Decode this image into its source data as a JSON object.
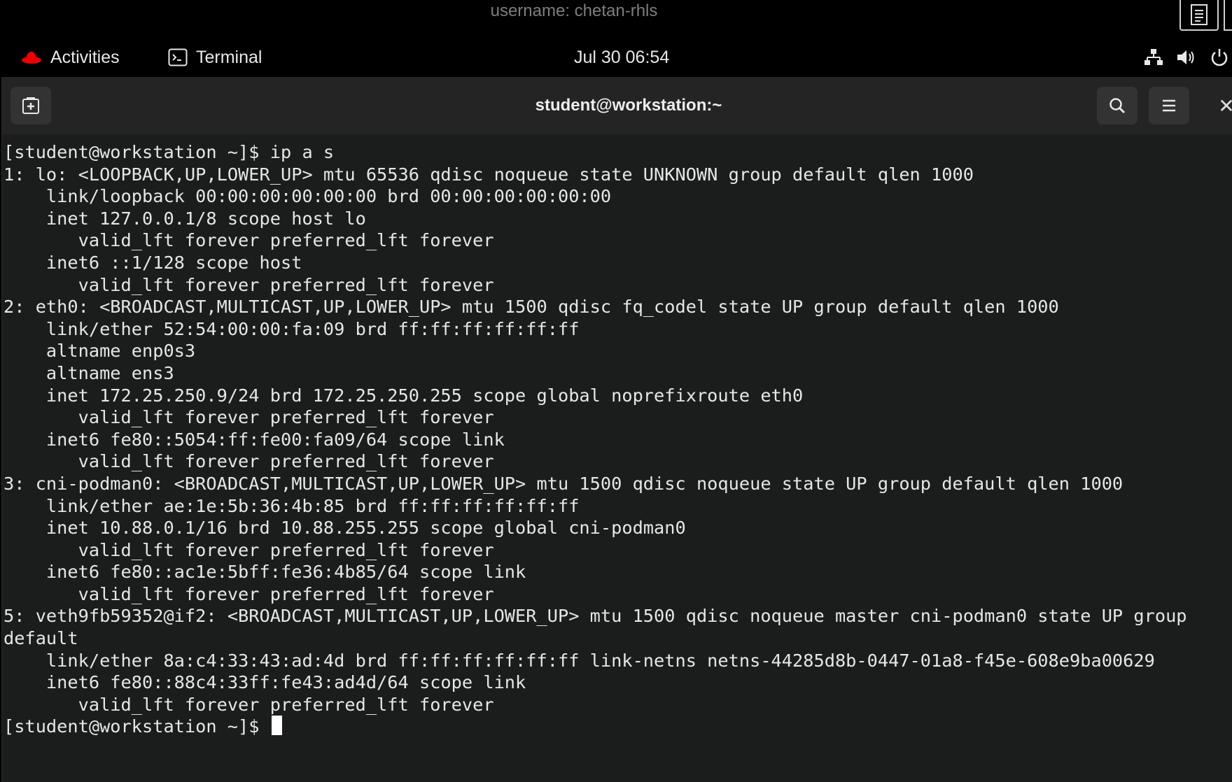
{
  "session": {
    "username_label": "username: chetan-rhls"
  },
  "panel": {
    "activities_label": "Activities",
    "app_label": "Terminal",
    "clock": "Jul 30  06:54",
    "icons": [
      "network-icon",
      "volume-icon",
      "power-icon"
    ]
  },
  "window": {
    "title": "student@workstation:~",
    "buttons": [
      "new-tab-icon",
      "search-icon",
      "hamburger-menu-icon",
      "close-icon"
    ]
  },
  "terminal": {
    "lines": [
      "[student@workstation ~]$ ip a s",
      "1: lo: <LOOPBACK,UP,LOWER_UP> mtu 65536 qdisc noqueue state UNKNOWN group default qlen 1000",
      "    link/loopback 00:00:00:00:00:00 brd 00:00:00:00:00:00",
      "    inet 127.0.0.1/8 scope host lo",
      "       valid_lft forever preferred_lft forever",
      "    inet6 ::1/128 scope host",
      "       valid_lft forever preferred_lft forever",
      "2: eth0: <BROADCAST,MULTICAST,UP,LOWER_UP> mtu 1500 qdisc fq_codel state UP group default qlen 1000",
      "    link/ether 52:54:00:00:fa:09 brd ff:ff:ff:ff:ff:ff",
      "    altname enp0s3",
      "    altname ens3",
      "    inet 172.25.250.9/24 brd 172.25.250.255 scope global noprefixroute eth0",
      "       valid_lft forever preferred_lft forever",
      "    inet6 fe80::5054:ff:fe00:fa09/64 scope link",
      "       valid_lft forever preferred_lft forever",
      "3: cni-podman0: <BROADCAST,MULTICAST,UP,LOWER_UP> mtu 1500 qdisc noqueue state UP group default qlen 1000",
      "    link/ether ae:1e:5b:36:4b:85 brd ff:ff:ff:ff:ff:ff",
      "    inet 10.88.0.1/16 brd 10.88.255.255 scope global cni-podman0",
      "       valid_lft forever preferred_lft forever",
      "    inet6 fe80::ac1e:5bff:fe36:4b85/64 scope link",
      "       valid_lft forever preferred_lft forever",
      "5: veth9fb59352@if2: <BROADCAST,MULTICAST,UP,LOWER_UP> mtu 1500 qdisc noqueue master cni-podman0 state UP group",
      "default",
      "    link/ether 8a:c4:33:43:ad:4d brd ff:ff:ff:ff:ff:ff link-netns netns-44285d8b-0447-01a8-f45e-608e9ba00629",
      "    inet6 fe80::88c4:33ff:fe43:ad4d/64 scope link",
      "       valid_lft forever preferred_lft forever"
    ],
    "prompt": "[student@workstation ~]$ "
  },
  "colors": {
    "terminal_bg": "#1b1d1c",
    "terminal_fg": "#e6e6e6",
    "headerbar_bg": "#242424",
    "panel_bg": "#000000",
    "redhat_red": "#ee0000"
  }
}
